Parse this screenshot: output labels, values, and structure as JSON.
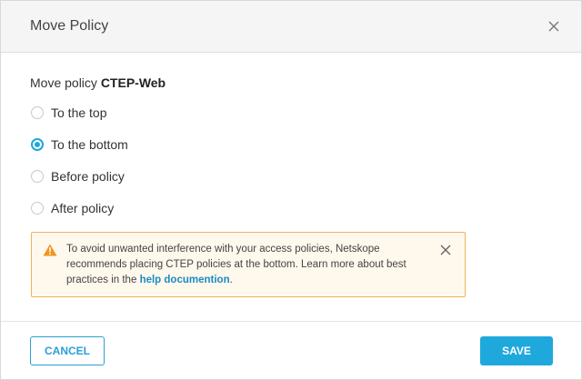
{
  "dialog": {
    "title": "Move Policy"
  },
  "prompt": {
    "prefix": "Move policy",
    "policy_name": "CTEP-Web"
  },
  "options": [
    {
      "label": "To the top",
      "checked": false
    },
    {
      "label": "To the bottom",
      "checked": true
    },
    {
      "label": "Before policy",
      "checked": false
    },
    {
      "label": "After policy",
      "checked": false
    }
  ],
  "warning": {
    "text": "To avoid unwanted interference with your access policies, Netskope recommends placing CTEP policies at the bottom. Learn more about best practices in the",
    "link_text": "help documention",
    "suffix": "."
  },
  "footer": {
    "cancel_label": "CANCEL",
    "save_label": "SAVE"
  },
  "colors": {
    "accent": "#1ea7d8",
    "warning_border": "#f0b25a",
    "warning_bg": "#fff8ec",
    "warning_icon": "#f0961e"
  }
}
